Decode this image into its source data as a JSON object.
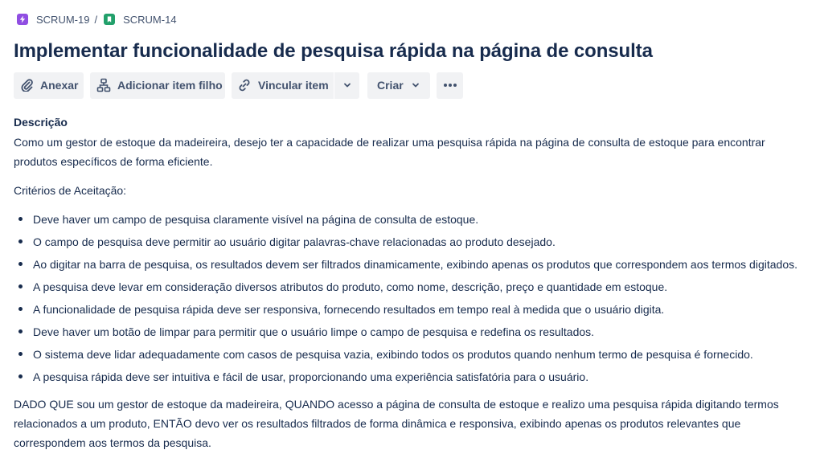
{
  "breadcrumb": {
    "parent": {
      "label": "SCRUM-19",
      "icon": "lightning-icon",
      "color": "#904ee2"
    },
    "separator": "/",
    "current": {
      "label": "SCRUM-14",
      "icon": "bookmark-icon",
      "color": "#22a06b"
    }
  },
  "title": "Implementar funcionalidade de pesquisa rápida na página de consulta",
  "toolbar": {
    "attach_label": "Anexar",
    "add_child_label": "Adicionar item filho",
    "link_label": "Vincular item",
    "create_label": "Criar"
  },
  "description": {
    "label": "Descrição",
    "intro": "Como um gestor de estoque da madeireira, desejo ter a capacidade de realizar uma pesquisa rápida na página de consulta de estoque para encontrar produtos específicos de forma eficiente.",
    "criteria_heading": "Critérios de Aceitação:",
    "criteria": [
      "Deve haver um campo de pesquisa claramente visível na página de consulta de estoque.",
      "O campo de pesquisa deve permitir ao usuário digitar palavras-chave relacionadas ao produto desejado.",
      "Ao digitar na barra de pesquisa, os resultados devem ser filtrados dinamicamente, exibindo apenas os produtos que correspondem aos termos digitados.",
      "A pesquisa deve levar em consideração diversos atributos do produto, como nome, descrição, preço e quantidade em estoque.",
      "A funcionalidade de pesquisa rápida deve ser responsiva, fornecendo resultados em tempo real à medida que o usuário digita.",
      "Deve haver um botão de limpar para permitir que o usuário limpe o campo de pesquisa e redefina os resultados.",
      "O sistema deve lidar adequadamente com casos de pesquisa vazia, exibindo todos os produtos quando nenhum termo de pesquisa é fornecido.",
      "A pesquisa rápida deve ser intuitiva e fácil de usar, proporcionando uma experiência satisfatória para o usuário."
    ],
    "scenario": "DADO QUE sou um gestor de estoque da madeireira, QUANDO acesso a página de consulta de estoque e realizo uma pesquisa rápida digitando termos relacionados a um produto, ENTÃO devo ver os resultados filtrados de forma dinâmica e responsiva, exibindo apenas os produtos relevantes que correspondem aos termos da pesquisa."
  }
}
